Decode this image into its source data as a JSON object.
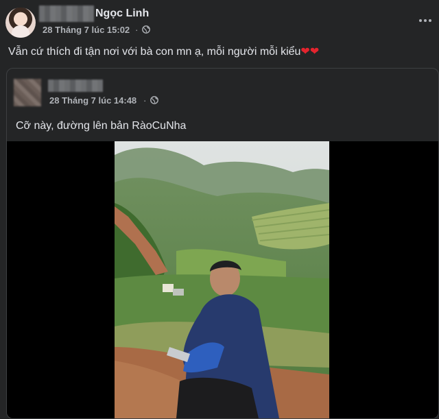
{
  "post": {
    "author_name": "Ngọc Linh",
    "time": "28 Tháng 7 lúc 15:02",
    "separator": "·",
    "caption": "Vẫn cứ thích đi tận nơi với bà con mn ạ, mỗi người mỗi kiểu",
    "hearts": "❤❤",
    "more_icon": "more-options-icon",
    "privacy_icon": "globe-icon"
  },
  "shared_post": {
    "time": "28 Tháng 7 lúc 14:48",
    "separator": "·",
    "caption": "Cỡ này, đường lên bản RàoCuNha",
    "privacy_icon": "globe-icon"
  },
  "colors": {
    "background": "#242526",
    "text_primary": "#e4e6eb",
    "text_secondary": "#b0b3b8",
    "heart": "#e4242e"
  }
}
